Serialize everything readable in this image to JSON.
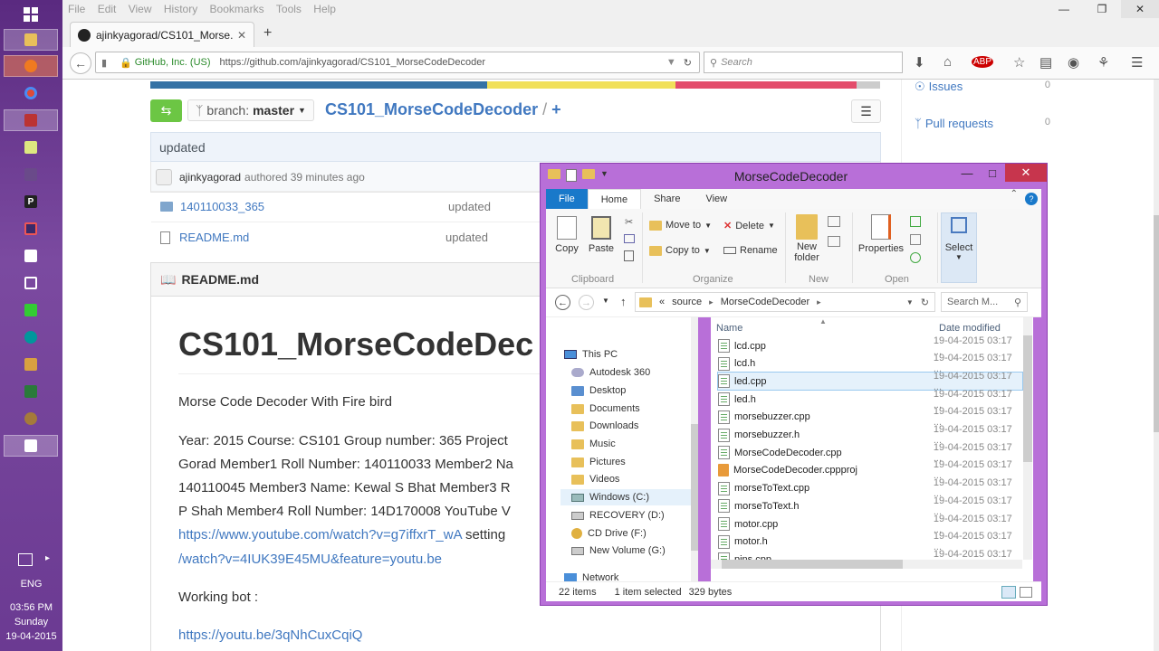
{
  "taskbar": {
    "language": "ENG",
    "time": "03:56 PM",
    "day": "Sunday",
    "date": "19-04-2015"
  },
  "browser": {
    "menu": [
      "File",
      "Edit",
      "View",
      "History",
      "Bookmarks",
      "Tools",
      "Help"
    ],
    "tab_title": "ajinkyagorad/CS101_Morse...",
    "site_identity": "GitHub, Inc. (US)",
    "url": "https://github.com/ajinkyagorad/CS101_MorseCodeDecoder",
    "search_placeholder": "Search"
  },
  "github": {
    "branch_label": "branch:",
    "branch_name": "master",
    "repo_name": "CS101_MorseCodeDecoder",
    "repo_sep": "/",
    "add": "+",
    "commit_message": "updated",
    "author": "ajinkyagorad",
    "authored": "authored 39 minutes ago",
    "files": [
      {
        "name": "140110033_365",
        "message": "updated",
        "type": "folder"
      },
      {
        "name": "README.md",
        "message": "updated",
        "type": "file"
      }
    ],
    "readme_header": "README.md",
    "readme_title": "CS101_MorseCodeDec",
    "readme_p1": "Morse Code Decoder With Fire bird",
    "readme_lines": [
      "Year: 2015 Course: CS101 Group number: 365 Project",
      "Gorad Member1 Roll Number: 140110033 Member2 Na",
      "140110045 Member3 Name: Kewal S Bhat Member3 R",
      "P Shah Member4 Roll Number: 14D170008 YouTube V"
    ],
    "readme_link1": "https://www.youtube.com/watch?v=g7iffxrT_wA",
    "readme_link1_tail": " setting",
    "readme_link2": "/watch?v=4IUK39E45MU&feature=youtu.be",
    "working_bot": "Working bot :",
    "readme_link3": "https://youtu.be/3qNhCuxCqiQ",
    "sidebar": [
      {
        "label": "Issues",
        "count": "0"
      },
      {
        "label": "Pull requests",
        "count": "0"
      }
    ]
  },
  "explorer": {
    "title": "MorseCodeDecoder",
    "ribbon_tabs": [
      "File",
      "Home",
      "Share",
      "View"
    ],
    "clipboard": {
      "copy": "Copy",
      "paste": "Paste",
      "label": "Clipboard"
    },
    "organize": {
      "move_to": "Move to",
      "copy_to": "Copy to",
      "delete": "Delete",
      "rename": "Rename",
      "label": "Organize"
    },
    "new": {
      "new_folder": "New folder",
      "label": "New"
    },
    "open": {
      "properties": "Properties",
      "label": "Open"
    },
    "select": {
      "select": "Select"
    },
    "breadcrumb": [
      "«",
      "source",
      "MorseCodeDecoder"
    ],
    "search_placeholder": "Search M...",
    "nav_items": [
      {
        "label": "This PC",
        "icon": "pc-icon"
      },
      {
        "label": "Autodesk 360",
        "icon": "cloud-icon"
      },
      {
        "label": "Desktop",
        "icon": "folder-icon"
      },
      {
        "label": "Documents",
        "icon": "folder-icon"
      },
      {
        "label": "Downloads",
        "icon": "folder-icon"
      },
      {
        "label": "Music",
        "icon": "folder-icon"
      },
      {
        "label": "Pictures",
        "icon": "folder-icon"
      },
      {
        "label": "Videos",
        "icon": "folder-icon"
      },
      {
        "label": "Windows (C:)",
        "icon": "drive-icon"
      },
      {
        "label": "RECOVERY (D:)",
        "icon": "drive-icon"
      },
      {
        "label": "CD Drive (F:)",
        "icon": "cd-icon"
      },
      {
        "label": "New Volume (G:)",
        "icon": "drive-icon"
      },
      {
        "label": "Network",
        "icon": "network-icon"
      }
    ],
    "columns": {
      "name": "Name",
      "date": "Date modified"
    },
    "files": [
      {
        "name": "lcd.cpp",
        "date": "19-04-2015 03:17 ..."
      },
      {
        "name": "lcd.h",
        "date": "19-04-2015 03:17 ..."
      },
      {
        "name": "led.cpp",
        "date": "19-04-2015 03:17 ..."
      },
      {
        "name": "led.h",
        "date": "19-04-2015 03:17 ..."
      },
      {
        "name": "morsebuzzer.cpp",
        "date": "19-04-2015 03:17 ..."
      },
      {
        "name": "morsebuzzer.h",
        "date": "19-04-2015 03:17 ..."
      },
      {
        "name": "MorseCodeDecoder.cpp",
        "date": "19-04-2015 03:17 ..."
      },
      {
        "name": "MorseCodeDecoder.cppproj",
        "date": "19-04-2015 03:17 ..."
      },
      {
        "name": "morseToText.cpp",
        "date": "19-04-2015 03:17 ..."
      },
      {
        "name": "morseToText.h",
        "date": "19-04-2015 03:17 ..."
      },
      {
        "name": "motor.cpp",
        "date": "19-04-2015 03:17 ..."
      },
      {
        "name": "motor.h",
        "date": "19-04-2015 03:17 ..."
      },
      {
        "name": "pins.cpp",
        "date": "19-04-2015 03:17 ..."
      }
    ],
    "selected_file": "led.cpp",
    "status_items": "22 items",
    "status_selected": "1 item selected",
    "status_size": "329 bytes"
  },
  "colors": {
    "lang_bar": [
      "#3572A5",
      "#f1e05a",
      "#e34c6b",
      "#ccc"
    ],
    "accent": "#4078c0",
    "explorer_frame": "#b86fd8"
  }
}
